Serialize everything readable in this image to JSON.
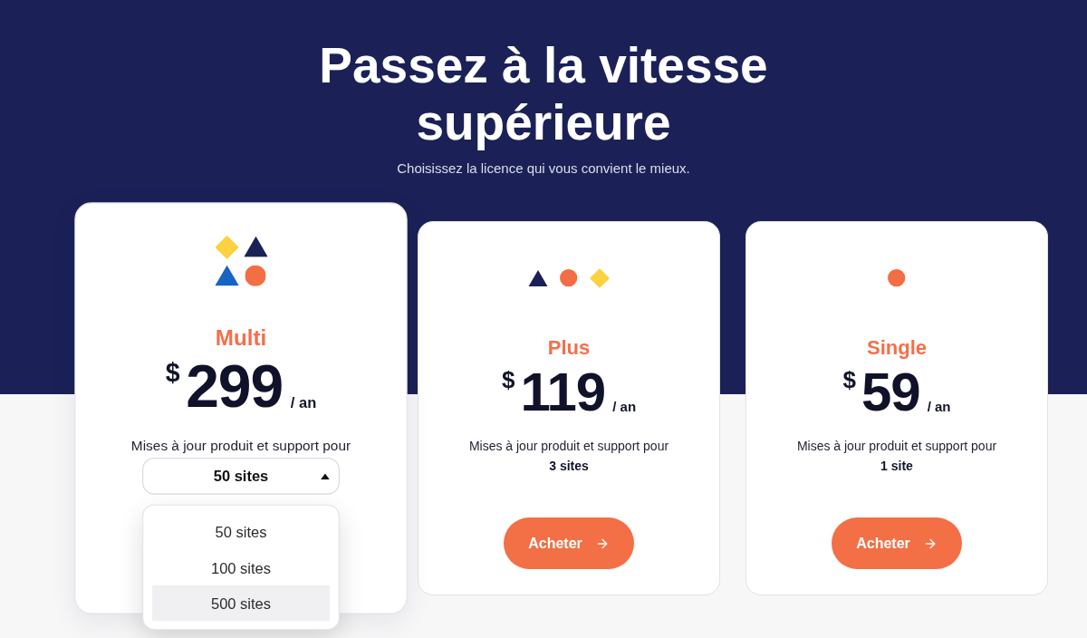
{
  "header": {
    "title": "Passez à la vitesse supérieure",
    "subtitle": "Choisissez la licence qui vous convient le mieux."
  },
  "plans": [
    {
      "kind": "select",
      "featured": true,
      "name": "Multi",
      "currency": "$",
      "amount": "299",
      "period": "/ an",
      "description": "Mises à jour produit et support pour",
      "select": {
        "value": "50 sites",
        "expanded": true,
        "options": [
          {
            "label": "50 sites",
            "highlighted": false
          },
          {
            "label": "100 sites",
            "highlighted": false
          },
          {
            "label": "500 sites",
            "highlighted": true
          }
        ]
      }
    },
    {
      "kind": "fixed",
      "featured": false,
      "name": "Plus",
      "currency": "$",
      "amount": "119",
      "period": "/ an",
      "description": "Mises à jour produit et support pour",
      "sites": "3 sites",
      "button": "Acheter"
    },
    {
      "kind": "fixed",
      "featured": false,
      "name": "Single",
      "currency": "$",
      "amount": "59",
      "period": "/ an",
      "description": "Mises à jour produit et support pour",
      "sites": "1 site",
      "button": "Acheter"
    }
  ]
}
